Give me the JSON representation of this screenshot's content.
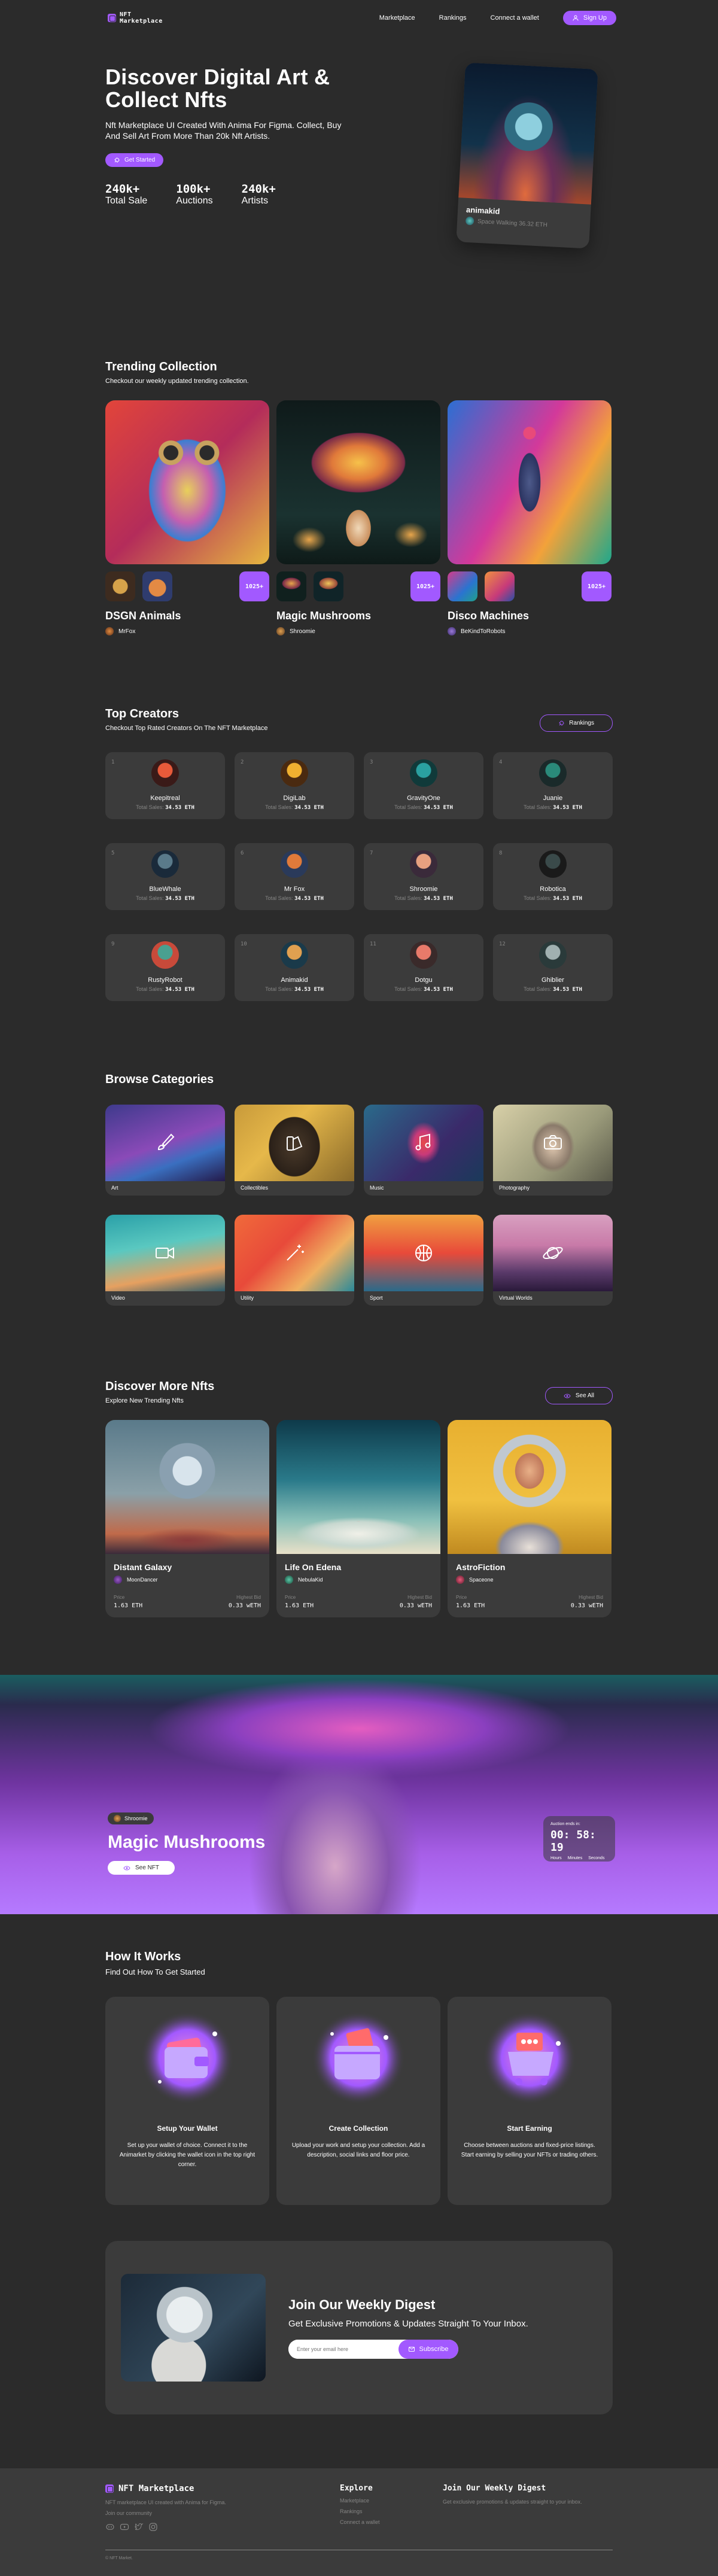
{
  "nav": {
    "logo_text": "NFT Marketplace",
    "links": [
      "Marketplace",
      "Rankings",
      "Connect a wallet"
    ],
    "signup_label": "Sign Up"
  },
  "hero": {
    "title": "Discover Digital Art & Collect Nfts",
    "subtitle": "Nft Marketplace UI Created With Anima For Figma. Collect, Buy And Sell Art From More Than 20k Nft Artists.",
    "cta_label": "Get Started",
    "stats": [
      {
        "value": "240k+",
        "label": "Total Sale"
      },
      {
        "value": "100k+",
        "label": "Auctions"
      },
      {
        "value": "240k+",
        "label": "Artists"
      }
    ],
    "card": {
      "title": "animakid",
      "artist": "Space Walking 36.32 ETH"
    }
  },
  "trending": {
    "title": "Trending Collection",
    "subtitle": "Checkout our weekly updated trending collection.",
    "collections": [
      {
        "name": "DSGN Animals",
        "artist": "MrFox",
        "more": "1025+"
      },
      {
        "name": "Magic Mushrooms",
        "artist": "Shroomie",
        "more": "1025+"
      },
      {
        "name": "Disco Machines",
        "artist": "BeKindToRobots",
        "more": "1025+"
      }
    ]
  },
  "creators": {
    "title": "Top Creators",
    "subtitle": "Checkout Top Rated Creators On The NFT Marketplace",
    "button_label": "Rankings",
    "sales_label": "Total Sales:",
    "items": [
      {
        "rank": "1",
        "name": "Keepitreal",
        "sales": "34.53 ETH"
      },
      {
        "rank": "2",
        "name": "DigiLab",
        "sales": "34.53 ETH"
      },
      {
        "rank": "3",
        "name": "GravityOne",
        "sales": "34.53 ETH"
      },
      {
        "rank": "4",
        "name": "Juanie",
        "sales": "34.53 ETH"
      },
      {
        "rank": "5",
        "name": "BlueWhale",
        "sales": "34.53 ETH"
      },
      {
        "rank": "6",
        "name": "Mr Fox",
        "sales": "34.53 ETH"
      },
      {
        "rank": "7",
        "name": "Shroomie",
        "sales": "34.53 ETH"
      },
      {
        "rank": "8",
        "name": "Robotica",
        "sales": "34.53 ETH"
      },
      {
        "rank": "9",
        "name": "RustyRobot",
        "sales": "34.53 ETH"
      },
      {
        "rank": "10",
        "name": "Animakid",
        "sales": "34.53 ETH"
      },
      {
        "rank": "11",
        "name": "Dotgu",
        "sales": "34.53 ETH"
      },
      {
        "rank": "12",
        "name": "Ghiblier",
        "sales": "34.53 ETH"
      }
    ]
  },
  "categories": {
    "title": "Browse Categories",
    "items": [
      "Art",
      "Collectibles",
      "Music",
      "Photography",
      "Video",
      "Utility",
      "Sport",
      "Virtual Worlds"
    ]
  },
  "discover": {
    "title": "Discover More Nfts",
    "subtitle": "Explore New Trending Nfts",
    "button_label": "See All",
    "price_label": "Price",
    "bid_label": "Highest Bid",
    "items": [
      {
        "name": "Distant Galaxy",
        "artist": "MoonDancer",
        "price": "1.63 ETH",
        "bid": "0.33 wETH"
      },
      {
        "name": "Life On Edena",
        "artist": "NebulaKid",
        "price": "1.63 ETH",
        "bid": "0.33 wETH"
      },
      {
        "name": "AstroFiction",
        "artist": "Spaceone",
        "price": "1.63 ETH",
        "bid": "0.33 wETH"
      }
    ]
  },
  "highlight": {
    "artist": "Shroomie",
    "title": "Magic Mushrooms",
    "button_label": "See NFT",
    "timer_label": "Auction ends in:",
    "time": "00: 58: 19",
    "units": [
      "Hours",
      "Minutes",
      "Seconds"
    ]
  },
  "how": {
    "title": "How It Works",
    "subtitle": "Find Out How To Get Started",
    "steps": [
      {
        "title": "Setup Your Wallet",
        "text": "Set up your wallet of choice. Connect it to the Animarket by clicking the wallet icon in the top right corner."
      },
      {
        "title": "Create Collection",
        "text": "Upload your work and setup your collection. Add a description, social links and floor price."
      },
      {
        "title": "Start Earning",
        "text": "Choose between auctions and fixed-price listings. Start earning by selling your NFTs or trading others."
      }
    ]
  },
  "digest": {
    "title": "Join Our Weekly Digest",
    "subtitle": "Get Exclusive Promotions & Updates Straight To Your Inbox.",
    "placeholder": "Enter your email here",
    "button_label": "Subscribe"
  },
  "footer": {
    "brand": "NFT Marketplace",
    "text1": "NFT marketplace UI created with Anima for Figma.",
    "text2": "Join our community",
    "explore_title": "Explore",
    "explore_links": [
      "Marketplace",
      "Rankings",
      "Connect a wallet"
    ],
    "digest_title": "Join Our Weekly Digest",
    "digest_text": "Get exclusive promotions & updates straight to your inbox.",
    "copyright": "© NFT Market."
  },
  "colors": {
    "background": "#2B2B2B",
    "surface": "#3B3B3B",
    "accent": "#A259FF",
    "muted": "#858584"
  }
}
